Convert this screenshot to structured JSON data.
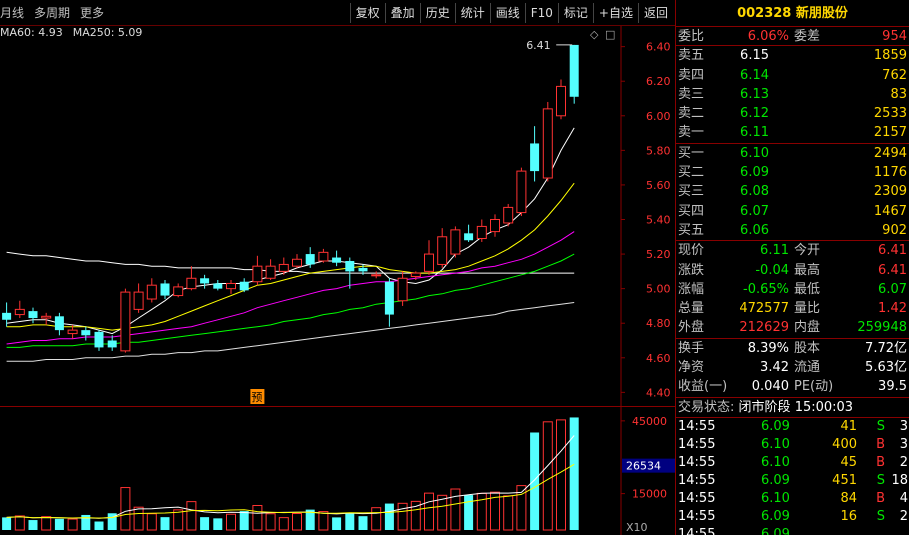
{
  "toolbar": {
    "left": [
      "月线",
      "多周期",
      "更多"
    ],
    "right": [
      "复权",
      "叠加",
      "历史",
      "统计",
      "画线",
      "F10",
      "标记",
      "+自选",
      "返回"
    ]
  },
  "legend": {
    "ma60": "MA60: 4.93",
    "ma250": "MA250: 5.09"
  },
  "stock": {
    "code": "002328",
    "name": "新朋股份"
  },
  "weibi": {
    "label1": "委比",
    "value1": "6.06%",
    "label2": "委差",
    "value2": "954"
  },
  "asks": [
    {
      "label": "卖五",
      "price": "6.15",
      "vol": "1859"
    },
    {
      "label": "卖四",
      "price": "6.14",
      "vol": "762"
    },
    {
      "label": "卖三",
      "price": "6.13",
      "vol": "83"
    },
    {
      "label": "卖二",
      "price": "6.12",
      "vol": "2533"
    },
    {
      "label": "卖一",
      "price": "6.11",
      "vol": "2157"
    }
  ],
  "bids": [
    {
      "label": "买一",
      "price": "6.10",
      "vol": "2494"
    },
    {
      "label": "买二",
      "price": "6.09",
      "vol": "1176"
    },
    {
      "label": "买三",
      "price": "6.08",
      "vol": "2309"
    },
    {
      "label": "买四",
      "price": "6.07",
      "vol": "1467"
    },
    {
      "label": "买五",
      "price": "6.06",
      "vol": "902"
    }
  ],
  "quote": [
    {
      "l1": "现价",
      "v1": "6.11",
      "l2": "今开",
      "v2": "6.41"
    },
    {
      "l1": "涨跌",
      "v1": "-0.04",
      "l2": "最高",
      "v2": "6.41"
    },
    {
      "l1": "涨幅",
      "v1": "-0.65%",
      "l2": "最低",
      "v2": "6.07"
    },
    {
      "l1": "总量",
      "v1": "472577",
      "l2": "量比",
      "v2": "1.42"
    },
    {
      "l1": "外盘",
      "v1": "212629",
      "l2": "内盘",
      "v2": "259948"
    }
  ],
  "fund": [
    {
      "l1": "换手",
      "v1": "8.39%",
      "l2": "股本",
      "v2": "7.72亿"
    },
    {
      "l1": "净资",
      "v1": "3.42",
      "l2": "流通",
      "v2": "5.63亿"
    },
    {
      "l1": "收益(一)",
      "v1": "0.040",
      "l2": "PE(动)",
      "v2": "39.5"
    }
  ],
  "status": {
    "label": "交易状态:",
    "value": "闭市阶段",
    "time": "15:00:03"
  },
  "ticks": [
    {
      "time": "14:55",
      "price": "6.09",
      "vol": "41",
      "bs": "S",
      "n": "3"
    },
    {
      "time": "14:55",
      "price": "6.10",
      "vol": "400",
      "bs": "B",
      "n": "3"
    },
    {
      "time": "14:55",
      "price": "6.10",
      "vol": "45",
      "bs": "B",
      "n": "2"
    },
    {
      "time": "14:55",
      "price": "6.09",
      "vol": "451",
      "bs": "S",
      "n": "18"
    },
    {
      "time": "14:55",
      "price": "6.10",
      "vol": "84",
      "bs": "B",
      "n": "4"
    },
    {
      "time": "14:55",
      "price": "6.09",
      "vol": "16",
      "bs": "S",
      "n": "2"
    },
    {
      "time": "14:55",
      "price": "6.09",
      "vol": "",
      "bs": "",
      "n": ""
    }
  ],
  "chart_data": [
    {
      "type": "candlestick",
      "ylim": [
        4.35,
        6.45
      ],
      "yticks": [
        "6.40",
        "6.20",
        "6.00",
        "5.80",
        "5.60",
        "5.40",
        "5.20",
        "5.00",
        "4.80",
        "4.60",
        "4.40"
      ],
      "high_marker": "6.41",
      "event_marker": "预",
      "candles": [
        {
          "o": 4.86,
          "c": 4.82,
          "h": 4.92,
          "l": 4.78
        },
        {
          "o": 4.85,
          "c": 4.88,
          "h": 4.93,
          "l": 4.83
        },
        {
          "o": 4.87,
          "c": 4.83,
          "h": 4.89,
          "l": 4.8
        },
        {
          "o": 4.83,
          "c": 4.84,
          "h": 4.86,
          "l": 4.79
        },
        {
          "o": 4.84,
          "c": 4.76,
          "h": 4.86,
          "l": 4.73
        },
        {
          "o": 4.74,
          "c": 4.76,
          "h": 4.79,
          "l": 4.71
        },
        {
          "o": 4.76,
          "c": 4.73,
          "h": 4.78,
          "l": 4.7
        },
        {
          "o": 4.75,
          "c": 4.66,
          "h": 4.76,
          "l": 4.64
        },
        {
          "o": 4.7,
          "c": 4.66,
          "h": 4.73,
          "l": 4.64
        },
        {
          "o": 4.64,
          "c": 4.98,
          "h": 5.0,
          "l": 4.63
        },
        {
          "o": 4.88,
          "c": 4.98,
          "h": 5.03,
          "l": 4.86
        },
        {
          "o": 4.94,
          "c": 5.02,
          "h": 5.06,
          "l": 4.92
        },
        {
          "o": 5.03,
          "c": 4.96,
          "h": 5.05,
          "l": 4.94
        },
        {
          "o": 4.96,
          "c": 5.01,
          "h": 5.03,
          "l": 4.95
        },
        {
          "o": 5.0,
          "c": 5.06,
          "h": 5.13,
          "l": 4.99
        },
        {
          "o": 5.06,
          "c": 5.03,
          "h": 5.08,
          "l": 5.0
        },
        {
          "o": 5.03,
          "c": 5.0,
          "h": 5.05,
          "l": 4.99
        },
        {
          "o": 5.0,
          "c": 5.03,
          "h": 5.05,
          "l": 4.97
        },
        {
          "o": 5.04,
          "c": 4.99,
          "h": 5.06,
          "l": 4.98
        },
        {
          "o": 5.04,
          "c": 5.13,
          "h": 5.19,
          "l": 5.02
        },
        {
          "o": 5.06,
          "c": 5.13,
          "h": 5.17,
          "l": 5.05
        },
        {
          "o": 5.1,
          "c": 5.14,
          "h": 5.18,
          "l": 5.08
        },
        {
          "o": 5.13,
          "c": 5.17,
          "h": 5.2,
          "l": 5.12
        },
        {
          "o": 5.2,
          "c": 5.14,
          "h": 5.24,
          "l": 5.12
        },
        {
          "o": 5.16,
          "c": 5.21,
          "h": 5.23,
          "l": 5.15
        },
        {
          "o": 5.18,
          "c": 5.15,
          "h": 5.22,
          "l": 5.13
        },
        {
          "o": 5.16,
          "c": 5.1,
          "h": 5.18,
          "l": 5.0
        },
        {
          "o": 5.12,
          "c": 5.1,
          "h": 5.14,
          "l": 5.08
        },
        {
          "o": 5.08,
          "c": 5.08,
          "h": 5.1,
          "l": 5.06
        },
        {
          "o": 5.04,
          "c": 4.85,
          "h": 5.06,
          "l": 4.78
        },
        {
          "o": 4.93,
          "c": 5.06,
          "h": 5.1,
          "l": 4.9
        },
        {
          "o": 5.07,
          "c": 5.09,
          "h": 5.1,
          "l": 5.05
        },
        {
          "o": 5.1,
          "c": 5.2,
          "h": 5.28,
          "l": 5.08
        },
        {
          "o": 5.14,
          "c": 5.3,
          "h": 5.35,
          "l": 5.12
        },
        {
          "o": 5.2,
          "c": 5.34,
          "h": 5.36,
          "l": 5.18
        },
        {
          "o": 5.32,
          "c": 5.28,
          "h": 5.37,
          "l": 5.27
        },
        {
          "o": 5.29,
          "c": 5.36,
          "h": 5.4,
          "l": 5.27
        },
        {
          "o": 5.33,
          "c": 5.4,
          "h": 5.43,
          "l": 5.3
        },
        {
          "o": 5.38,
          "c": 5.47,
          "h": 5.49,
          "l": 5.36
        },
        {
          "o": 5.44,
          "c": 5.68,
          "h": 5.7,
          "l": 5.42
        },
        {
          "o": 5.84,
          "c": 5.68,
          "h": 5.94,
          "l": 5.62
        },
        {
          "o": 5.64,
          "c": 6.04,
          "h": 6.08,
          "l": 5.62
        },
        {
          "o": 6.0,
          "c": 6.17,
          "h": 6.21,
          "l": 5.98
        },
        {
          "o": 6.41,
          "c": 6.11,
          "h": 6.41,
          "l": 6.07
        }
      ],
      "series": [
        {
          "name": "MA60",
          "color": "#ffffff",
          "values": [
            5.21,
            5.2,
            5.19,
            5.19,
            5.18,
            5.17,
            5.16,
            5.16,
            5.15,
            5.14,
            5.14,
            5.13,
            5.13,
            5.12,
            5.12,
            5.12,
            5.12,
            5.12,
            5.11,
            5.11,
            5.1,
            5.1,
            5.1,
            5.09,
            5.09,
            5.09,
            5.09,
            5.09,
            5.09,
            5.09,
            5.09,
            5.09,
            5.09,
            5.09,
            5.09,
            5.09,
            5.09,
            5.09,
            5.09,
            5.09,
            5.09,
            5.09,
            5.09,
            5.09
          ]
        },
        {
          "name": "MA5",
          "color": "#ffffff",
          "values": [
            4.8,
            4.81,
            4.82,
            4.82,
            4.8,
            4.79,
            4.78,
            4.76,
            4.74,
            4.78,
            4.83,
            4.88,
            4.93,
            4.99,
            5.01,
            5.02,
            5.03,
            5.03,
            5.03,
            5.05,
            5.07,
            5.09,
            5.12,
            5.14,
            5.16,
            5.16,
            5.15,
            5.14,
            5.13,
            5.06,
            5.04,
            5.03,
            5.05,
            5.11,
            5.2,
            5.24,
            5.3,
            5.34,
            5.37,
            5.44,
            5.52,
            5.64,
            5.8,
            5.93
          ]
        },
        {
          "name": "MA10",
          "color": "#ffff00",
          "values": [
            4.78,
            4.78,
            4.79,
            4.79,
            4.78,
            4.78,
            4.78,
            4.77,
            4.76,
            4.77,
            4.78,
            4.79,
            4.81,
            4.84,
            4.87,
            4.9,
            4.93,
            4.96,
            4.99,
            5.02,
            5.03,
            5.05,
            5.07,
            5.09,
            5.1,
            5.11,
            5.12,
            5.13,
            5.13,
            5.11,
            5.1,
            5.09,
            5.09,
            5.1,
            5.11,
            5.13,
            5.16,
            5.19,
            5.23,
            5.28,
            5.34,
            5.42,
            5.51,
            5.61
          ]
        },
        {
          "name": "MA20",
          "color": "#ff00ff",
          "values": [
            4.68,
            4.69,
            4.7,
            4.7,
            4.71,
            4.71,
            4.72,
            4.72,
            4.72,
            4.73,
            4.74,
            4.75,
            4.76,
            4.77,
            4.78,
            4.8,
            4.82,
            4.84,
            4.86,
            4.89,
            4.91,
            4.93,
            4.95,
            4.97,
            4.99,
            5.0,
            5.02,
            5.03,
            5.04,
            5.04,
            5.05,
            5.06,
            5.07,
            5.08,
            5.09,
            5.1,
            5.12,
            5.13,
            5.15,
            5.17,
            5.2,
            5.24,
            5.28,
            5.33
          ]
        },
        {
          "name": "MA30",
          "color": "#00ff00",
          "values": [
            4.66,
            4.66,
            4.67,
            4.67,
            4.67,
            4.67,
            4.68,
            4.68,
            4.68,
            4.69,
            4.69,
            4.7,
            4.71,
            4.72,
            4.73,
            4.74,
            4.75,
            4.76,
            4.77,
            4.78,
            4.79,
            4.81,
            4.82,
            4.83,
            4.85,
            4.86,
            4.88,
            4.89,
            4.91,
            4.92,
            4.93,
            4.94,
            4.96,
            4.97,
            4.99,
            5.0,
            5.02,
            5.04,
            5.06,
            5.08,
            5.1,
            5.13,
            5.16,
            5.2
          ]
        },
        {
          "name": "MA250",
          "color": "#e0e0e0",
          "values": [
            4.58,
            4.58,
            4.58,
            4.59,
            4.59,
            4.59,
            4.6,
            4.6,
            4.6,
            4.61,
            4.61,
            4.62,
            4.62,
            4.63,
            4.63,
            4.64,
            4.64,
            4.65,
            4.66,
            4.67,
            4.68,
            4.69,
            4.7,
            4.71,
            4.72,
            4.73,
            4.74,
            4.75,
            4.76,
            4.77,
            4.78,
            4.79,
            4.8,
            4.81,
            4.82,
            4.83,
            4.84,
            4.85,
            4.87,
            4.88,
            4.89,
            4.9,
            4.91,
            4.92
          ]
        }
      ]
    },
    {
      "type": "bar",
      "ylim": [
        0,
        47000
      ],
      "yticks": [
        "45000",
        "15000"
      ],
      "current_label": "26534",
      "unit": "X10",
      "values": [
        5200,
        5800,
        4100,
        5500,
        4600,
        4500,
        6200,
        3500,
        6900,
        17500,
        9400,
        6700,
        5300,
        8300,
        11700,
        5300,
        4800,
        6500,
        7800,
        10100,
        6700,
        5100,
        6800,
        8400,
        7600,
        5200,
        6900,
        5700,
        9200,
        10900,
        11000,
        11800,
        15200,
        14300,
        16900,
        14400,
        15100,
        15600,
        14100,
        18300,
        40200,
        44600,
        45400,
        46400
      ],
      "series": [
        {
          "name": "MAVOL5",
          "color": "#ffffff"
        },
        {
          "name": "MAVOL10",
          "color": "#ffff00"
        }
      ]
    }
  ]
}
